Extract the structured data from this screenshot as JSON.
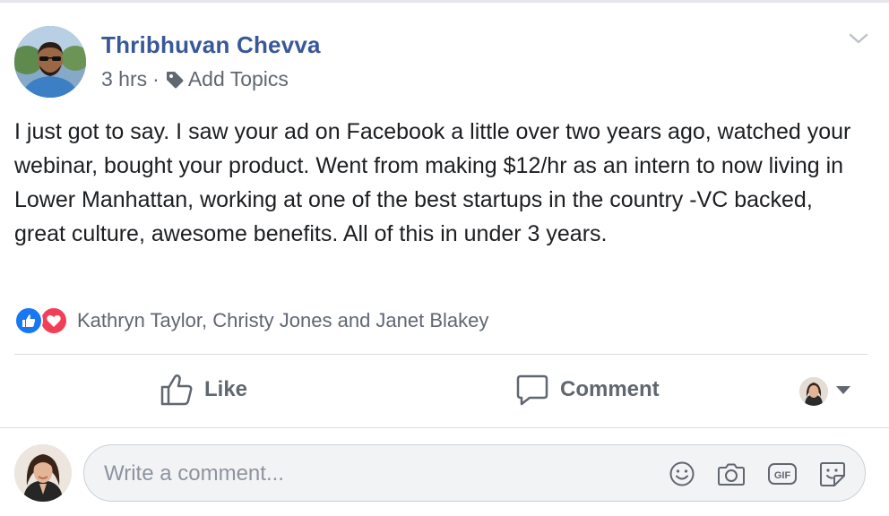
{
  "post": {
    "author": "Thribhuvan Chevva",
    "time": "3 hrs",
    "separator": "·",
    "add_topics": "Add Topics",
    "text": "I just got to say. I saw your ad on Facebook a little over two years ago, watched your webinar, bought your product. Went from making $12/hr as an intern to now living in Lower Manhattan, working at one of the best startups in the country -VC backed, great culture, awesome benefits. All of this in under 3 years."
  },
  "reactions": {
    "types": [
      "like",
      "love"
    ],
    "names": "Kathryn Taylor, Christy Jones and Janet Blakey"
  },
  "actions": {
    "like_label": "Like",
    "comment_label": "Comment"
  },
  "comment_box": {
    "placeholder": "Write a comment...",
    "icons": [
      "emoji-icon",
      "camera-icon",
      "gif-icon",
      "sticker-icon"
    ]
  },
  "colors": {
    "author_link": "#385898",
    "like_blue": "#1877f2",
    "love_red": "#f33e58",
    "muted_text": "#606770"
  }
}
